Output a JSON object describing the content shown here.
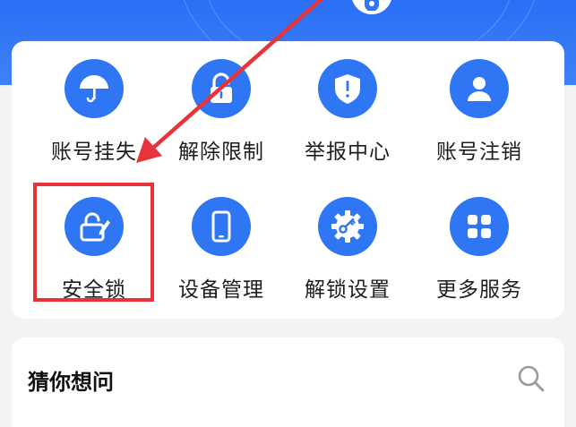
{
  "colors": {
    "brand": "#2f76f5",
    "banner": "#3a7df6",
    "highlight": "#e8333a",
    "text": "#1d1d1f",
    "background": "#f2f3f5"
  },
  "services": [
    {
      "label": "账号挂失",
      "icon": "umbrella-icon"
    },
    {
      "label": "解除限制",
      "icon": "unlock-icon"
    },
    {
      "label": "举报中心",
      "icon": "shield-alert-icon"
    },
    {
      "label": "账号注销",
      "icon": "user-icon"
    },
    {
      "label": "安全锁",
      "icon": "lock-edit-icon"
    },
    {
      "label": "设备管理",
      "icon": "phone-icon"
    },
    {
      "label": "解锁设置",
      "icon": "gear-key-icon"
    },
    {
      "label": "更多服务",
      "icon": "grid-icon"
    }
  ],
  "faq": {
    "title": "猜你想问",
    "icon": "search-icon"
  },
  "annotation": {
    "highlighted": "安全锁",
    "arrow": "red-arrow"
  }
}
